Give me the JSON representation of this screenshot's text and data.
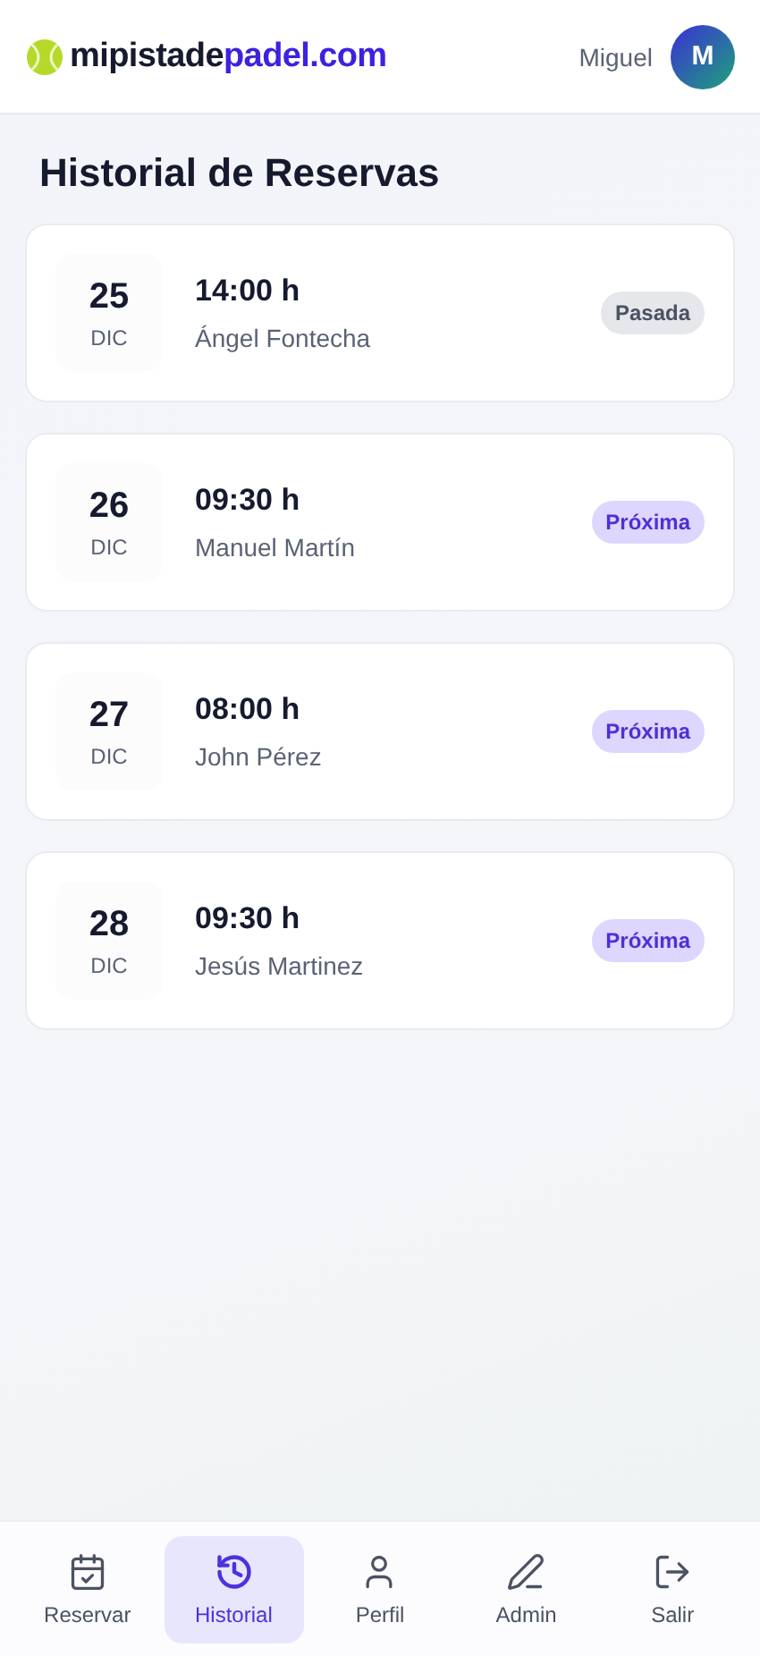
{
  "header": {
    "logo_dark": "mipistade",
    "logo_accent": "padel.com",
    "user_name": "Miguel",
    "avatar_initial": "M"
  },
  "title": "Historial de Reservas",
  "bookings": [
    {
      "day": "25",
      "month": "DIC",
      "time": "14:00 h",
      "name": "Ángel Fontecha",
      "status": "Pasada",
      "kind": "past"
    },
    {
      "day": "26",
      "month": "DIC",
      "time": "09:30 h",
      "name": "Manuel Martín",
      "status": "Próxima",
      "kind": "upcoming"
    },
    {
      "day": "27",
      "month": "DIC",
      "time": "08:00 h",
      "name": "John Pérez",
      "status": "Próxima",
      "kind": "upcoming"
    },
    {
      "day": "28",
      "month": "DIC",
      "time": "09:30 h",
      "name": "Jesús Martinez",
      "status": "Próxima",
      "kind": "upcoming"
    }
  ],
  "nav": [
    {
      "label": "Reservar",
      "kind": "calendar",
      "selected": false
    },
    {
      "label": "Historial",
      "kind": "history",
      "selected": true
    },
    {
      "label": "Perfil",
      "kind": "user",
      "selected": false
    },
    {
      "label": "Admin",
      "kind": "pen",
      "selected": false
    },
    {
      "label": "Salir",
      "kind": "logout",
      "selected": false
    }
  ]
}
